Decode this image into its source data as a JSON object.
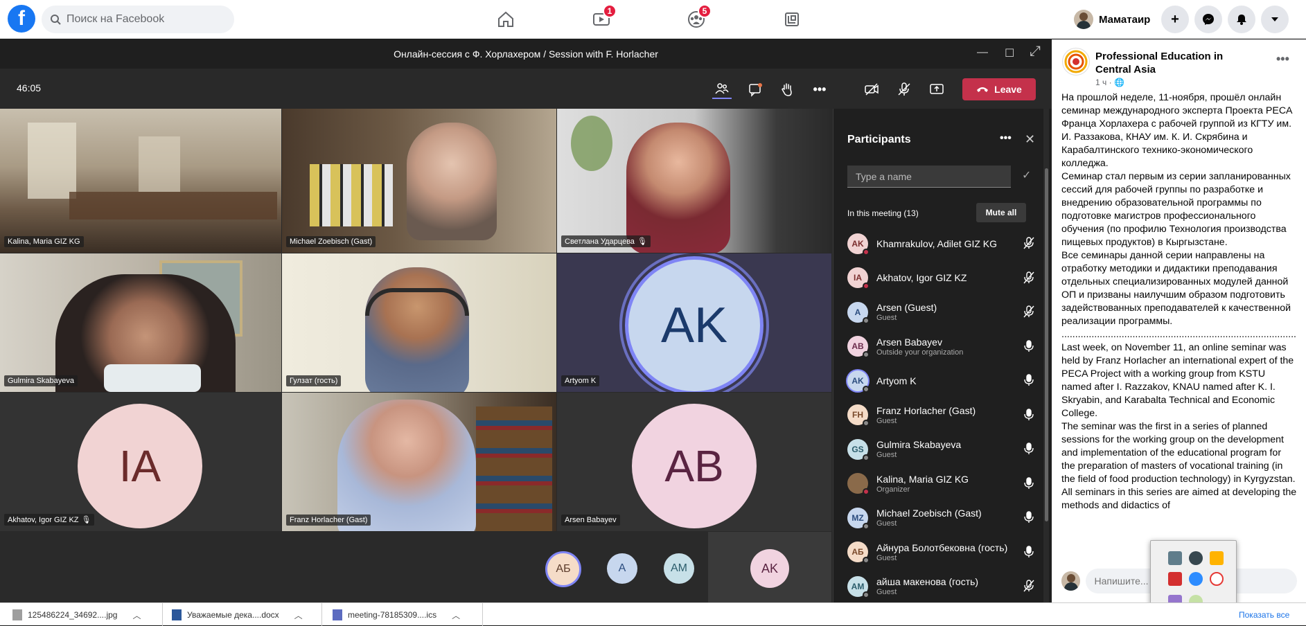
{
  "facebook": {
    "logo": "f",
    "search_placeholder": "Поиск на Facebook",
    "nav_badges": {
      "watch": "1",
      "groups": "5"
    },
    "profile_name": "Маматаир"
  },
  "teams": {
    "title": "Онлайн-сессия с Ф. Хорлахером / Session with F. Horlacher",
    "timer": "46:05",
    "leave_label": "Leave",
    "tiles": [
      {
        "name": "Kalina, Maria GIZ KG"
      },
      {
        "name": "Michael Zoebisch (Gast)"
      },
      {
        "name": "Светлана Ударцева"
      },
      {
        "name": "Gulmira Skabayeva"
      },
      {
        "name": "Гулзат (гость)"
      },
      {
        "name": "Artyom K",
        "initials": "AK"
      },
      {
        "name": "Akhatov, Igor GIZ KZ",
        "initials": "IA"
      },
      {
        "name": "Franz Horlacher (Gast)"
      },
      {
        "name": "Arsen Babayev",
        "initials": "AB"
      }
    ],
    "bottom_avatars": [
      "АБ",
      "A",
      "AM",
      "AK"
    ]
  },
  "participants": {
    "title": "Participants",
    "search_placeholder": "Type a name",
    "in_meeting": "In this meeting (13)",
    "mute_all": "Mute all",
    "list": [
      {
        "initials": "AK",
        "name": "Khamrakulov, Adilet GIZ KG",
        "role": "",
        "mic": "muted",
        "status": "#c4314b",
        "bg": "#f1d3d3",
        "fg": "#7a2d2d"
      },
      {
        "initials": "IA",
        "name": "Akhatov, Igor GIZ KZ",
        "role": "",
        "mic": "muted",
        "status": "#c4314b",
        "bg": "#f1d3d3",
        "fg": "#7a2d2d"
      },
      {
        "initials": "A",
        "name": "Arsen (Guest)",
        "role": "Guest",
        "mic": "muted",
        "status": "#8a8a8a",
        "bg": "#c7d7ee",
        "fg": "#2b4c7e"
      },
      {
        "initials": "AB",
        "name": "Arsen Babayev",
        "role": "Outside your organization",
        "mic": "on",
        "status": "#8a8a8a",
        "bg": "#f1d3e0",
        "fg": "#6b2b4c"
      },
      {
        "initials": "AK",
        "name": "Artyom K",
        "role": "",
        "mic": "on",
        "status": "#8a8a8a",
        "bg": "#c7d7ee",
        "fg": "#2b4c7e"
      },
      {
        "initials": "FH",
        "name": "Franz Horlacher (Gast)",
        "role": "Guest",
        "mic": "on",
        "status": "#8a8a8a",
        "bg": "#f5dcc8",
        "fg": "#7a4a2b"
      },
      {
        "initials": "GS",
        "name": "Gulmira Skabayeva",
        "role": "Guest",
        "mic": "on",
        "status": "#8a8a8a",
        "bg": "#c7e0e8",
        "fg": "#2b5c6b"
      },
      {
        "initials": "",
        "name": "Kalina, Maria GIZ KG",
        "role": "Organizer",
        "mic": "on",
        "status": "#c4314b",
        "bg": "#8a6a4a",
        "fg": "#fff"
      },
      {
        "initials": "MZ",
        "name": "Michael Zoebisch (Gast)",
        "role": "Guest",
        "mic": "on",
        "status": "#8a8a8a",
        "bg": "#c7d7ee",
        "fg": "#2b4c7e"
      },
      {
        "initials": "АБ",
        "name": "Айнура Болотбековна (гость)",
        "role": "Guest",
        "mic": "on",
        "status": "#8a8a8a",
        "bg": "#f5dcc8",
        "fg": "#7a4a2b"
      },
      {
        "initials": "AM",
        "name": "айша макенова (гость)",
        "role": "Guest",
        "mic": "muted",
        "status": "#8a8a8a",
        "bg": "#c7e0e8",
        "fg": "#2b5c6b"
      }
    ]
  },
  "post": {
    "org_name": "Professional Education in Central Asia",
    "time": "1 ч ·",
    "text": "На прошлой неделе, 11-ноября, прошёл онлайн семинар международного эксперта Проекта PECA Франца Хорлахера с рабочей группой из КГТУ им. И. Раззакова, КНАУ им. К. И. Скрябина и Карабалтинского технико-экономического колледжа.\nСеминар стал первым из серии запланированных сессий для рабочей группы по разработке и внедрению образовательной программы по подготовке магистров профессионального обучения (по профилю Технология производства пищевых продуктов) в Кыргызстане.\nВсе семинары данной серии направлены на отработку методики и дидактики преподавания отдельных специализированных модулей данной ОП и призваны наилучшим образом подготовить задействованных преподавателей к качественной реализации программы.\n..................................................................................................\nLast week, on November 11, an online seminar was held by Franz Horlacher an international expert of the PECA Project with a working group from KSTU named after I. Razzakov, KNAU named after K. I. Skryabin, and Karabalta Technical and Economic College.\nThe seminar was the first in a series of planned sessions for the working group on the development and implementation of the educational program for the preparation of masters of vocational training (in the field of food production technology) in Kyrgyzstan.\nAll seminars in this series are aimed at developing the methods and didactics of",
    "comment_placeholder": "Напишите..."
  },
  "downloads": {
    "items": [
      "125486224_34692....jpg",
      "Уважаемые дека....docx",
      "meeting-78185309....ics"
    ],
    "show_all": "Показать все"
  }
}
